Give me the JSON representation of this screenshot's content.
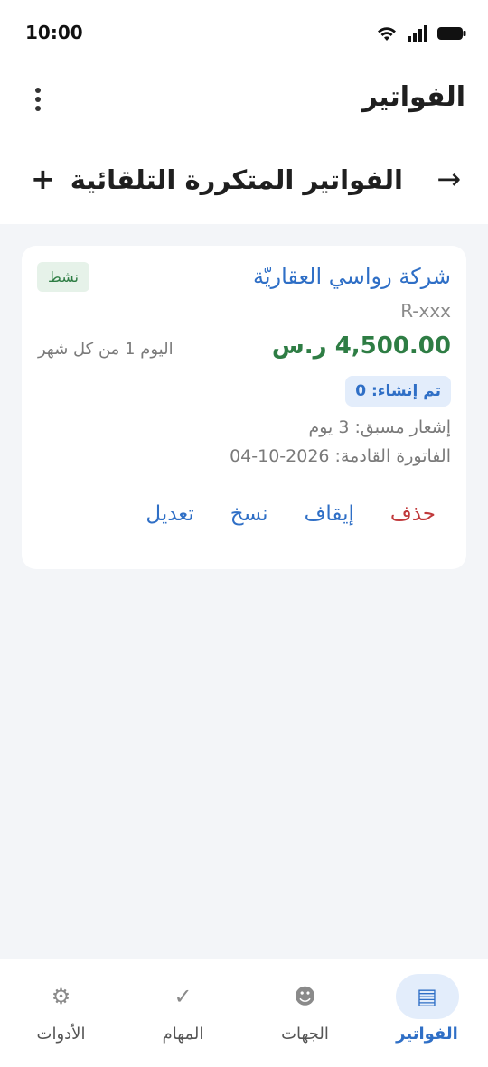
{
  "status_bar": {
    "time": "10:00"
  },
  "app_bar": {
    "title": "الفواتير"
  },
  "sub_header": {
    "title": "الفواتير المتكررة التلقائية",
    "add_label": "+",
    "back_label": "→"
  },
  "invoice_card": {
    "company": "شركة رواسي العقاريّة",
    "status": "نشط",
    "code": "R-xxx",
    "amount": "4,500.00 ر.س",
    "schedule": "اليوم 1 من كل شهر",
    "created_count": "تم إنشاء: 0",
    "advance_notice": "إشعار مسبق: 3 يوم",
    "next_invoice": "الفاتورة القادمة: 2026-10-04",
    "actions": {
      "edit": "تعديل",
      "copy": "نسخ",
      "pause": "إيقاف",
      "delete": "حذف"
    }
  },
  "bottom_nav": {
    "items": [
      {
        "label": "الفواتير",
        "icon": "invoice-list-icon",
        "glyph": "▤",
        "active": true
      },
      {
        "label": "الجهات",
        "icon": "contacts-icon",
        "glyph": "☻",
        "active": false
      },
      {
        "label": "المهام",
        "icon": "checkmark-icon",
        "glyph": "✓",
        "active": false
      },
      {
        "label": "الأدوات",
        "icon": "tools-gear-icon",
        "glyph": "⚙",
        "active": false
      }
    ]
  },
  "colors": {
    "accent": "#2f6fc6",
    "success": "#2e7d44",
    "danger": "#c0393b",
    "background": "#f3f5f8"
  }
}
